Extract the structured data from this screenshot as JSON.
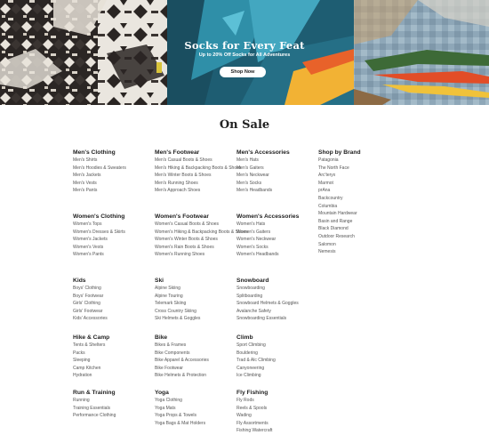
{
  "hero": {
    "title": "Socks for Every Feat",
    "subtitle": "Up to 20% Off Socks for All Adventures",
    "button_label": "Shop Now"
  },
  "sale": {
    "title": "On Sale",
    "columns": [
      [
        {
          "title": "Men's Clothing",
          "links": [
            "Men's Shirts",
            "Men's Hoodies & Sweaters",
            "Men's Jackets",
            "Men's Vests",
            "Men's Pants"
          ]
        },
        {
          "title": "Women's Clothing",
          "links": [
            "Women's Tops",
            "Women's Dresses & Skirts",
            "Women's Jackets",
            "Women's Vests",
            "Women's Pants"
          ]
        },
        {
          "title": "Kids",
          "links": [
            "Boys' Clothing",
            "Boys' Footwear",
            "Girls' Clothing",
            "Girls' Footwear",
            "Kids' Accessories"
          ]
        },
        {
          "title": "Hike & Camp",
          "links": [
            "Tents & Shelters",
            "Packs",
            "Sleeping",
            "Camp Kitchen",
            "Hydration"
          ]
        },
        {
          "title": "Run & Training",
          "links": [
            "Running",
            "Training Essentials",
            "Performance Clothing"
          ]
        }
      ],
      [
        {
          "title": "Men's Footwear",
          "links": [
            "Men's Casual Boots & Shoes",
            "Men's Hiking & Backpacking Boots & Shoes",
            "Men's Winter Boots & Shoes",
            "Men's Running Shoes",
            "Men's Approach Shoes"
          ]
        },
        {
          "title": "Women's Footwear",
          "links": [
            "Women's Casual Boots & Shoes",
            "Women's Hiking & Backpacking Boots & Shoes",
            "Women's Winter Boots & Shoes",
            "Women's Rain Boots & Shoes",
            "Women's Running Shoes"
          ]
        },
        {
          "title": "Ski",
          "links": [
            "Alpine Skiing",
            "Alpine Touring",
            "Telemark Skiing",
            "Cross Country Skiing",
            "Ski Helmets & Goggles"
          ]
        },
        {
          "title": "Bike",
          "links": [
            "Bikes & Frames",
            "Bike Components",
            "Bike Apparel & Accessories",
            "Bike Footwear",
            "Bike Helmets & Protection"
          ]
        },
        {
          "title": "Yoga",
          "links": [
            "Yoga Clothing",
            "Yoga Mats",
            "Yoga Props & Towels",
            "Yoga Bags & Mat Holders"
          ]
        }
      ],
      [
        {
          "title": "Men's Accessories",
          "links": [
            "Men's Hats",
            "Men's Gaiters",
            "Men's Neckwear",
            "Men's Socks",
            "Men's Headbands"
          ]
        },
        {
          "title": "Women's Accessories",
          "links": [
            "Women's Hats",
            "Women's Gaiters",
            "Women's Neckwear",
            "Women's Socks",
            "Women's Headbands"
          ]
        },
        {
          "title": "Snowboard",
          "links": [
            "Snowboarding",
            "Splitboarding",
            "Snowboard Helmets & Goggles",
            "Avalanche Safety",
            "Snowboarding Essentials"
          ]
        },
        {
          "title": "Climb",
          "links": [
            "Sport Climbing",
            "Bouldering",
            "Trad & Alc Climbing",
            "Canyoneering",
            "Ice Climbing"
          ]
        },
        {
          "title": "Fly Fishing",
          "links": [
            "Fly Rods",
            "Reels & Spools",
            "Wading",
            "Fly Assortments",
            "Fishing Watercraft"
          ]
        }
      ],
      [
        {
          "title": "Shop by Brand",
          "links": [
            "Patagonia",
            "The North Face",
            "Arc'teryx",
            "Marmot",
            "prAna",
            "Backcountry",
            "Columbia",
            "Mountain Hardwear",
            "Basin and Range",
            "Black Diamond",
            "Outdoor Research",
            "Salomon",
            "Nemesis"
          ]
        }
      ]
    ]
  }
}
